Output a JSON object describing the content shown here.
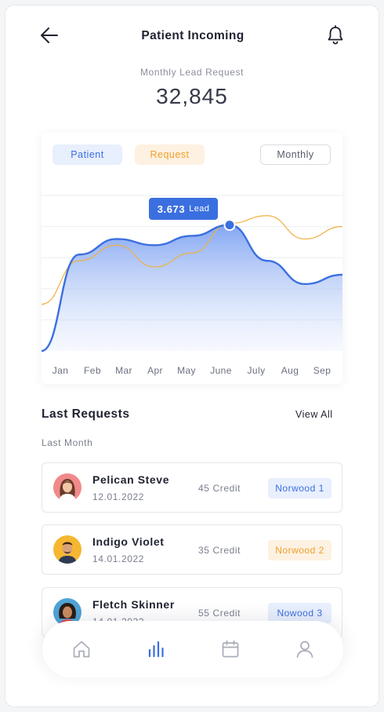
{
  "header": {
    "title": "Patient Incoming",
    "back_icon": "arrow-left-icon",
    "notification_icon": "bell-icon"
  },
  "summary": {
    "label": "Monthly Lead Request",
    "value": "32,845"
  },
  "chart": {
    "filters": {
      "patient": "Patient",
      "request": "Request",
      "period": "Monthly"
    },
    "tooltip": {
      "value": "3.673",
      "unit": "Lead"
    },
    "colors": {
      "patient": "#3b6fe0",
      "request": "#f0b040",
      "grid": "#eceef2"
    }
  },
  "chart_data": {
    "type": "area",
    "categories": [
      "Jan",
      "Feb",
      "Mar",
      "Apr",
      "May",
      "June",
      "July",
      "Aug",
      "Sep"
    ],
    "series": [
      {
        "name": "Patient",
        "values": [
          0.0,
          0.62,
          0.72,
          0.68,
          0.74,
          0.81,
          0.58,
          0.43,
          0.49
        ]
      },
      {
        "name": "Request",
        "values": [
          0.3,
          0.58,
          0.68,
          0.54,
          0.63,
          0.82,
          0.87,
          0.72,
          0.8
        ]
      }
    ],
    "highlight": {
      "category": "June",
      "value": "3.673",
      "unit": "Lead"
    },
    "ylim": [
      0,
      1
    ],
    "grid": true
  },
  "requests": {
    "title": "Last Requests",
    "view_all": "View All",
    "period": "Last Month",
    "items": [
      {
        "name": "Pelican Steve",
        "date": "12.01.2022",
        "credit": "45 Credit",
        "badge": "Norwood 1",
        "badge_color": "blue"
      },
      {
        "name": "Indigo Violet",
        "date": "14.01.2022",
        "credit": "35 Credit",
        "badge": "Norwood 2",
        "badge_color": "orange"
      },
      {
        "name": "Fletch Skinner",
        "date": "14.01.2022",
        "credit": "55 Credit",
        "badge": "Nowood 3",
        "badge_color": "blue"
      }
    ]
  },
  "nav": {
    "items": [
      {
        "icon": "home-icon",
        "active": false
      },
      {
        "icon": "bar-chart-icon",
        "active": true
      },
      {
        "icon": "calendar-icon",
        "active": false
      },
      {
        "icon": "user-icon",
        "active": false
      }
    ],
    "active_color": "#3b6fe0",
    "inactive_color": "#a9adb8"
  }
}
